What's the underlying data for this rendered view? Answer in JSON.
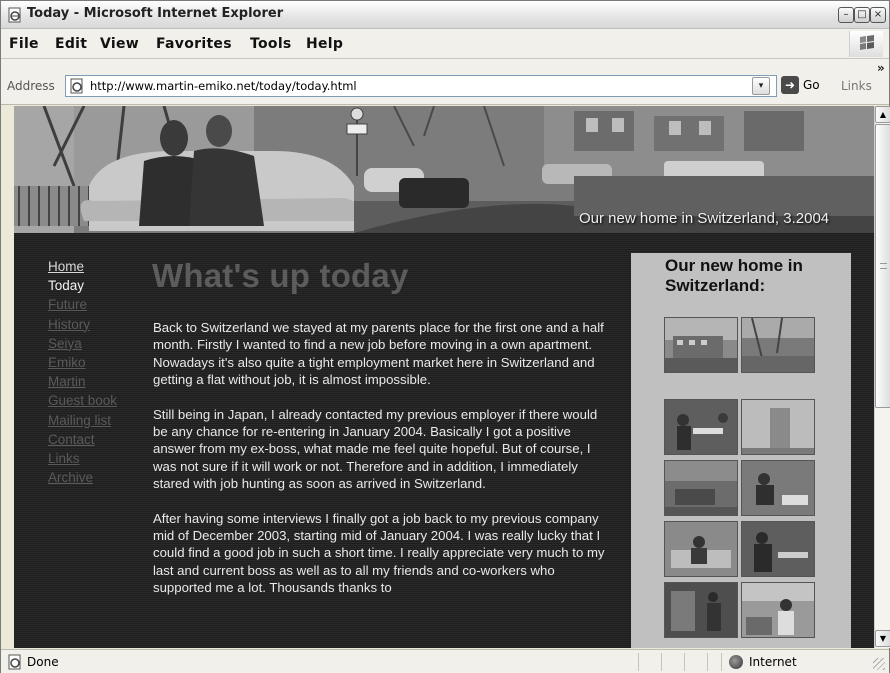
{
  "window": {
    "title": "Today - Microsoft Internet Explorer",
    "controls": {
      "minimize": "–",
      "maximize": "□",
      "close": "×"
    }
  },
  "menubar": {
    "items": [
      "File",
      "Edit",
      "View",
      "Favorites",
      "Tools",
      "Help"
    ]
  },
  "addressbar": {
    "label": "Address",
    "url": "http://www.martin-emiko.net/today/today.html",
    "go_label": "Go",
    "links_label": "Links",
    "chevron": "»",
    "dropdown": "▾"
  },
  "banner": {
    "caption": "Our new home in Switzerland, 3.2004"
  },
  "nav": {
    "items": [
      {
        "label": "Home",
        "state": "link-bright"
      },
      {
        "label": "Today",
        "state": "current"
      },
      {
        "label": "Future",
        "state": "link"
      },
      {
        "label": "History",
        "state": "link"
      },
      {
        "label": "Seiya",
        "state": "link"
      },
      {
        "label": "Emiko",
        "state": "link"
      },
      {
        "label": "Martin",
        "state": "link"
      },
      {
        "label": "Guest book",
        "state": "link"
      },
      {
        "label": "Mailing list",
        "state": "link"
      },
      {
        "label": "Contact",
        "state": "link"
      },
      {
        "label": "Links",
        "state": "link"
      },
      {
        "label": "Archive",
        "state": "link"
      }
    ]
  },
  "main": {
    "heading": "What's up today",
    "paragraphs": [
      "Back to Switzerland we stayed at my parents place for the first one and a half month. Firstly I wanted to find a new job before moving in a own apartment. Nowadays it's also quite a tight employment market here in Switzerland and getting a flat without job, it is almost impossible.",
      "Still being in Japan, I already contacted my previous employer if there would be any chance for re-entering in January 2004. Basically I got a positive answer from my ex-boss, what made me feel quite hopeful. But of course, I was not sure if it will work or not. Therefore and in addition, I immediately stared with job hunting as soon as arrived in Switzerland.",
      "After having some interviews I finally got a job back to my previous company mid of December 2003, starting mid of January 2004. I was really lucky that I could find a good job in such a short time. I really appreciate very much to my last and current boss as well as to all my friends and co-workers who supported me a lot. Thousands thanks to"
    ]
  },
  "sidebar": {
    "title": "Our new home in Switzerland:",
    "thumbnails": [
      "exterior-building",
      "exterior-yard",
      "interior-couple-table",
      "interior-doorway",
      "interior-living-room",
      "interior-person-laptop",
      "interior-person-sofa",
      "interior-person-desk",
      "interior-kitchen",
      "interior-person-kitchen"
    ]
  },
  "statusbar": {
    "status": "Done",
    "zone": "Internet"
  },
  "scrollbar": {
    "up": "▲",
    "down": "▼"
  },
  "theme": {
    "page_background": "#1a1a1a",
    "heading_color": "#5c5c5c",
    "sidebar_background": "#c0c0c0"
  }
}
